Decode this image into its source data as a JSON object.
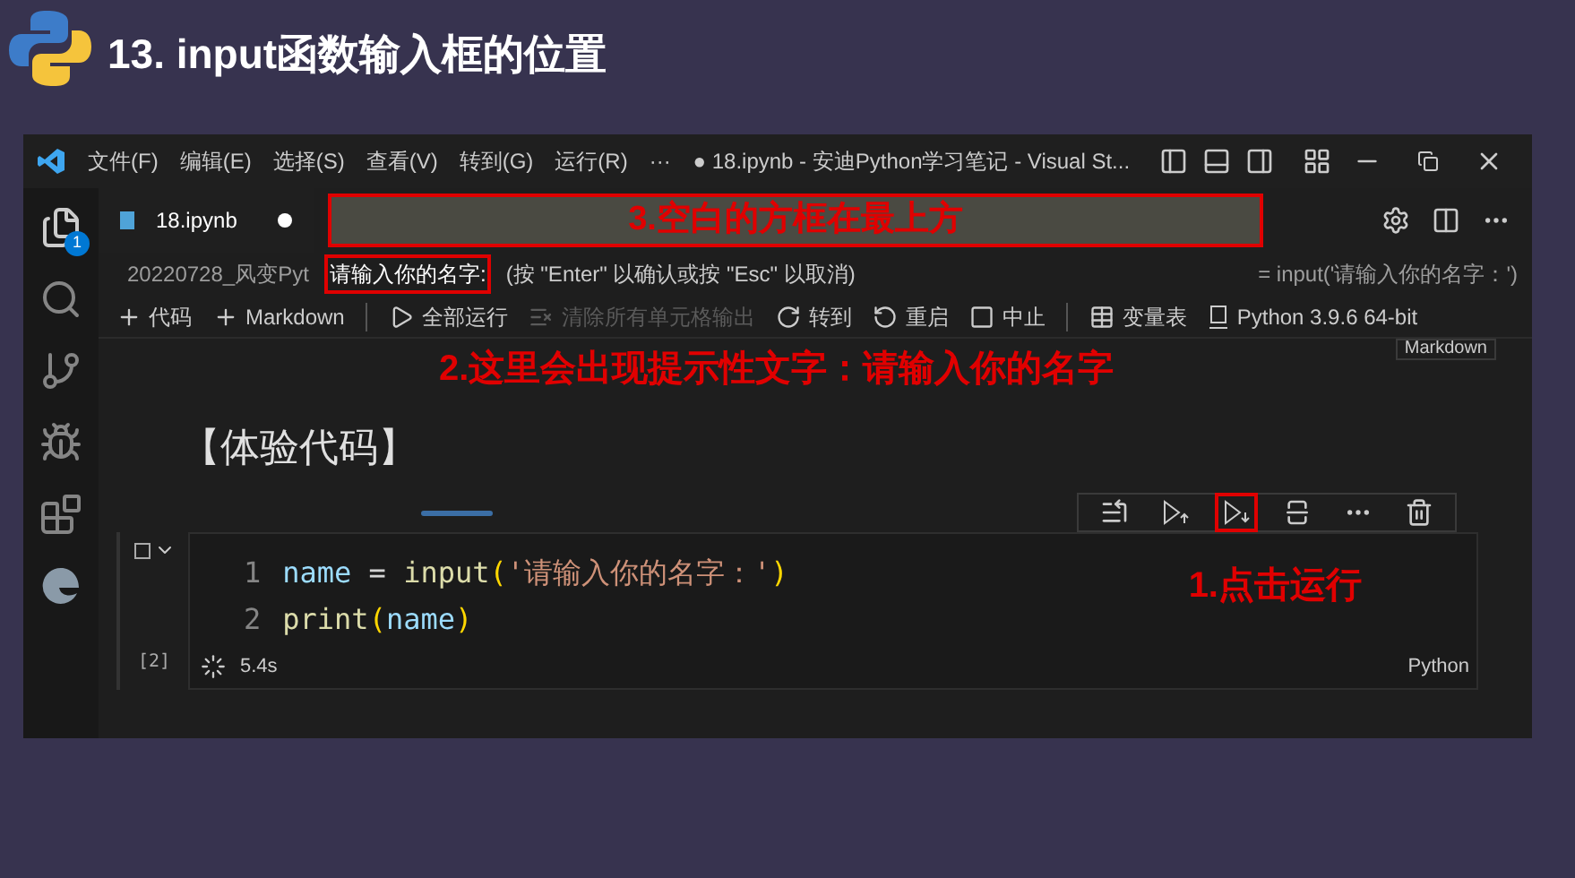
{
  "slide": {
    "title": "13. input函数输入框的位置"
  },
  "window": {
    "menu": [
      "文件(F)",
      "编辑(E)",
      "选择(S)",
      "查看(V)",
      "转到(G)",
      "运行(R)",
      "···"
    ],
    "title": "● 18.ipynb - 安迪Python学习笔记 - Visual St..."
  },
  "activity_bar": {
    "badge": "1"
  },
  "tab": {
    "label": "18.ipynb",
    "modified": true
  },
  "quick_input": {
    "annotation": "3.空白的方框在最上方"
  },
  "breadcrumb": "20220728_风变Pyt",
  "prompt": {
    "label": "请输入你的名字:",
    "hint": "(按 \"Enter\" 以确认或按 \"Esc\" 以取消)"
  },
  "code_peek": "= input('请输入你的名字：')",
  "toolbar": [
    {
      "kind": "add",
      "label": "代码",
      "disabled": false,
      "separator": false
    },
    {
      "kind": "add",
      "label": "Markdown",
      "disabled": false,
      "separator": false
    },
    {
      "kind": "run-all",
      "label": "全部运行",
      "disabled": false,
      "separator": true
    },
    {
      "kind": "clear",
      "label": "清除所有单元格输出",
      "disabled": true,
      "separator": false
    },
    {
      "kind": "goto",
      "label": "转到",
      "disabled": false,
      "separator": false
    },
    {
      "kind": "restart",
      "label": "重启",
      "disabled": false,
      "separator": false
    },
    {
      "kind": "stop",
      "label": "中止",
      "disabled": false,
      "separator": false
    },
    {
      "kind": "variables",
      "label": "变量表",
      "disabled": false,
      "separator": true
    },
    {
      "kind": "kernel",
      "label": "Python 3.9.6 64-bit",
      "disabled": false,
      "separator": false
    }
  ],
  "prompt_annotation": "2.这里会出现提示性文字：请输入你的名字",
  "markdown_tag": "Markdown",
  "markdown_cell": "【体验代码】",
  "cell_toolbar": [
    {
      "kind": "run-by-line",
      "highlighted": false
    },
    {
      "kind": "run-above",
      "highlighted": false
    },
    {
      "kind": "run-below",
      "highlighted": true
    },
    {
      "kind": "split",
      "highlighted": false
    },
    {
      "kind": "more",
      "highlighted": false
    },
    {
      "kind": "delete",
      "highlighted": false
    }
  ],
  "run_annotation": "1.点击运行",
  "code_cell": {
    "lines": [
      {
        "number": "1",
        "tokens": [
          {
            "kind": "name",
            "text": "name"
          },
          {
            "kind": "op",
            "text": " = "
          },
          {
            "kind": "func",
            "text": "input"
          },
          {
            "kind": "paren",
            "text": "("
          },
          {
            "kind": "string",
            "text": "'请输入你的名字：'"
          },
          {
            "kind": "paren",
            "text": ")"
          }
        ]
      },
      {
        "number": "2",
        "tokens": [
          {
            "kind": "func",
            "text": "print"
          },
          {
            "kind": "paren",
            "text": "("
          },
          {
            "kind": "name",
            "text": "name"
          },
          {
            "kind": "paren",
            "text": ")"
          }
        ]
      }
    ],
    "checked": false,
    "execution_count": "[2]",
    "duration": "5.4s",
    "language": "Python"
  }
}
